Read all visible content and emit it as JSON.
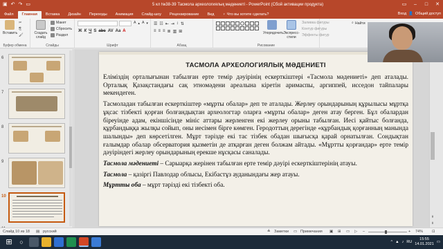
{
  "titlebar": {
    "title": "5 кл №38-39 Тасмола археологиялық мәдениеті - PowerPoint (Сбой активации продукта)",
    "qa_icons": [
      "save-icon",
      "undo-icon",
      "redo-icon"
    ]
  },
  "tabs": [
    "Файл",
    "Главная",
    "Вставка",
    "Дизайн",
    "Переходы",
    "Анимация",
    "Слайд-шоу",
    "Рецензирование",
    "Вид"
  ],
  "active_tab": "Главная",
  "tell_me": "Что вы хотите сделать?",
  "account": {
    "signin": "Вход",
    "share": "Общий доступ"
  },
  "ribbon": {
    "clipboard": {
      "paste": "Вставить",
      "label": "Буфер обмена"
    },
    "slides": {
      "new_slide": "Создать слайд",
      "layout": "Макет",
      "reset": "Сбросить",
      "section": "Раздел",
      "label": "Слайды"
    },
    "font": {
      "label": "Шрифт",
      "name": "",
      "size": ""
    },
    "paragraph": {
      "label": "Абзац"
    },
    "drawing": {
      "label": "Рисование",
      "arrange": "Упорядочить",
      "quick_styles": "Экспресс-стили",
      "shape_fill": "Заливка фигуры",
      "shape_outline": "Контур фигуры",
      "shape_effects": "Эффекты фигур"
    },
    "editing": {
      "find": "Найти",
      "label": "Редактирование"
    }
  },
  "thumbnails": [
    {
      "num": "6"
    },
    {
      "num": "7"
    },
    {
      "num": "8"
    },
    {
      "num": "9"
    },
    {
      "num": "10"
    },
    {
      "num": "11"
    }
  ],
  "slide": {
    "title": "ТАСМОЛА АРХЕОЛОГИЯЛЫҚ МӘДЕНИЕТІ",
    "p1": "Еліміздің орталығынан табылған ерте темір дәуірінің ескерткіштері «Тасмола мәдениеті» деп аталады. Орталық Қазақстандағы сақ этномәдени ареалына кіретін аримаспы, аргиппей, исседон тайпалары мекендеген.",
    "p2": "Тасмоладан табылған ескерткіштер «мұрты обалар» деп те аталады. Жерлеу орындарының құрылысы мұртқа ұқсас тізбекті қорған болғандықтан археологтар оларға «мұрты обалар» деген атау берген. Бұл обалардан біреуінде адам, екіншісінде мініс аттары жерленген екі жерлеу орыны табылған. Иесі қайтыс болғанда, құрбандыққа жылқы сойып, оны иесімен бірге көмген. Геродоттың дерегінде «құрбандық қорғанның манында шалынды» деп көрсетілген. Мұрт тәрізде екі тас тізбек обадан шығысқа қарай орнатылған. Сондықтан ғалымдар обалар обсерватория қызметін де атқарған деген болжам айтады. «Мұртты қорғандар» ерте темір дәуіріндегі жерлеу орындарының ерекше нұсқасы саналады.",
    "p3_term": "Тасмола мәдениеті",
    "p3_text": " – Сарыарқа жерінен табылған ерте темір дәуірі ескерткіштерінің атауы.",
    "p4_term": "Тасмола",
    "p4_text": " – қазіргі Павлодар облысы, Екібастұз ауданындағы жер атауы.",
    "p5_term": "Мұртты оба",
    "p5_text": " – мұрт тәрізді екі тізбекті оба."
  },
  "statusbar": {
    "slide_count": "Слайд 10 из 18",
    "language": "русский",
    "notes": "Заметки",
    "comments": "Примечания",
    "zoom": "74%"
  },
  "taskbar": {
    "lang": "RU",
    "time": "15:55",
    "date": "14.01.2021"
  },
  "colors": {
    "accent": "#b7472a",
    "active_thumb": "#c55a11",
    "slide_bg": "#f3f0e8",
    "taskbar": "#1c2b3a"
  }
}
